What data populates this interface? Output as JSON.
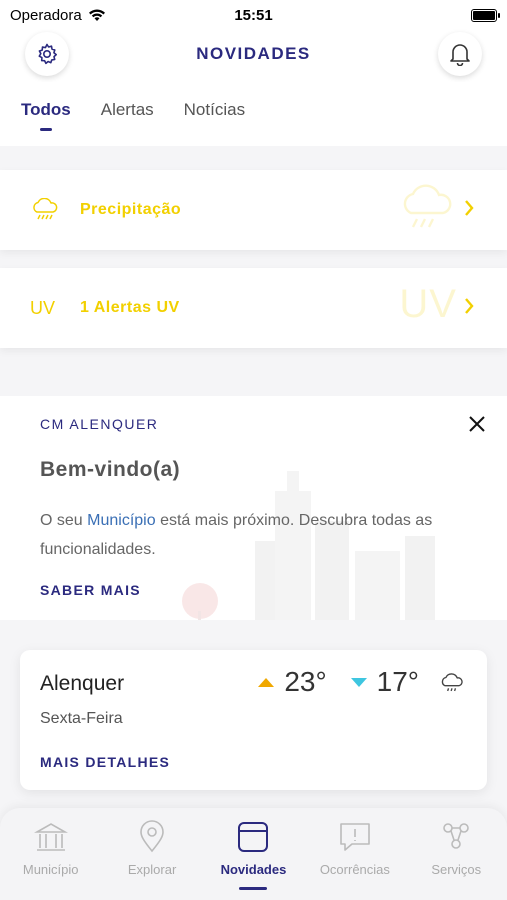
{
  "status": {
    "carrier": "Operadora",
    "time": "15:51"
  },
  "header": {
    "title": "NOVIDADES"
  },
  "tabs": [
    {
      "label": "Todos",
      "active": true
    },
    {
      "label": "Alertas",
      "active": false
    },
    {
      "label": "Notícias",
      "active": false
    }
  ],
  "alerts": [
    {
      "icon": "rain-cloud-icon",
      "label": "Precipitação"
    },
    {
      "icon_text": "UV",
      "label": "1 Alertas UV",
      "ghost_text": "UV"
    }
  ],
  "welcome": {
    "municipality": "CM ALENQUER",
    "title": "Bem-vindo(a)",
    "text_before": "O seu ",
    "text_highlight": "Município",
    "text_after": " está mais próximo. Descubra todas as funcionalidades.",
    "link": "SABER MAIS"
  },
  "weather": {
    "city": "Alenquer",
    "day": "Sexta-Feira",
    "max": "23°",
    "min": "17°",
    "link": "MAIS DETALHES"
  },
  "nav": [
    {
      "label": "Município",
      "icon": "building-icon",
      "active": false
    },
    {
      "label": "Explorar",
      "icon": "location-pin-icon",
      "active": false
    },
    {
      "label": "Novidades",
      "icon": "news-icon",
      "active": true
    },
    {
      "label": "Ocorrências",
      "icon": "report-icon",
      "active": false
    },
    {
      "label": "Serviços",
      "icon": "services-icon",
      "active": false
    }
  ],
  "colors": {
    "primary": "#2b2a7f",
    "alert_yellow": "#f2d000",
    "max_temp": "#f0a800",
    "min_temp": "#3ec6e0"
  }
}
